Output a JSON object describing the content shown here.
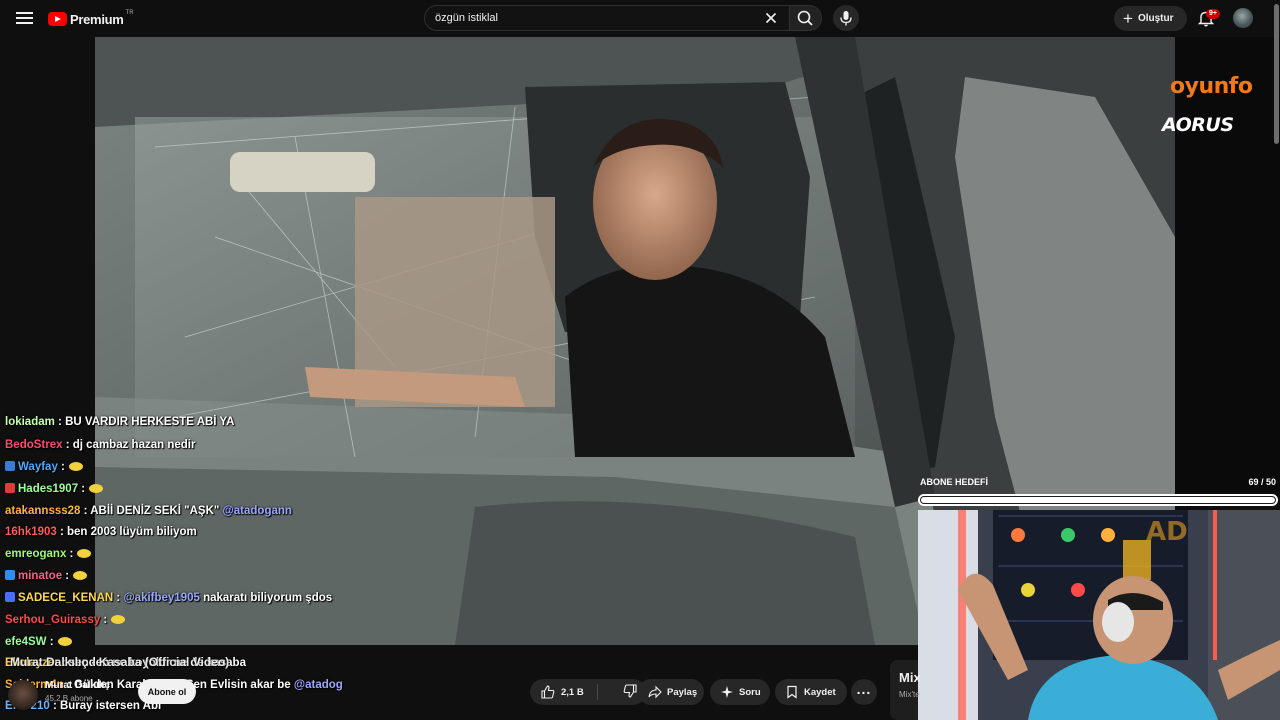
{
  "header": {
    "logo_text": "Premium",
    "logo_sup": "TR",
    "search_value": "özgün istiklal",
    "create_label": "Oluştur",
    "notification_badge": "9+"
  },
  "overlay": {
    "sponsor_1": "oyunfo",
    "sponsor_2": "AORUS",
    "goal_label": "ABONE HEDEFİ",
    "goal_count": "69 / 50",
    "goal_progress_fraction": 1.0
  },
  "chat": [
    {
      "user": "lokiadam",
      "user_color": "#c8ffb0",
      "message": " : BU VARDIR HERKESTE ABİ YA",
      "mention": "",
      "emote": false,
      "badge": ""
    },
    {
      "user": "BedoStrex",
      "user_color": "#ff4a6e",
      "message": " : dj cambaz hazan nedir",
      "mention": "",
      "emote": false,
      "badge": ""
    },
    {
      "user": "Wayfay",
      "user_color": "#4aa8ff",
      "message": " :",
      "mention": "",
      "emote": true,
      "badge": "#3a7bd5"
    },
    {
      "user": "Hades1907",
      "user_color": "#9aff9a",
      "message": " :",
      "mention": "",
      "emote": true,
      "badge": "#e03a3a"
    },
    {
      "user": "atakannsss28",
      "user_color": "#ffb347",
      "message": " : ABİİ DENİZ SEKİ \"AŞK\"",
      "mention": " @atadogann",
      "emote": false,
      "badge": ""
    },
    {
      "user": "16hk1903",
      "user_color": "#ff5b5b",
      "message": " : ben 2003 lüyüm biliyom",
      "mention": "",
      "emote": false,
      "badge": ""
    },
    {
      "user": "emreoganx",
      "user_color": "#9aff6a",
      "message": " :",
      "mention": "",
      "emote": true,
      "badge": ""
    },
    {
      "user": "minatoe",
      "user_color": "#ff5b8a",
      "message": " :",
      "mention": "",
      "emote": true,
      "badge": "#2b8fff"
    },
    {
      "user": "SADECE_KENAN",
      "user_color": "#ffd84a",
      "message": " : ",
      "mention": "@akifbey1905",
      "suffix": " nakaratı biliyorum şdos",
      "emote": false,
      "badge": "#4a6cff"
    },
    {
      "user": "Serhou_Guirassy",
      "user_color": "#ff4a4a",
      "message": " :",
      "mention": "",
      "emote": true,
      "badge": ""
    },
    {
      "user": "efe4SW",
      "user_color": "#9aff9a",
      "message": " :",
      "mention": "",
      "emote": true,
      "badge": ""
    },
    {
      "user": "Ekolayzer",
      "user_color": "#ffd84a",
      "message": " : senden ne koyolur ne de kasaba",
      "mention": "",
      "emote": false,
      "badge": ""
    },
    {
      "user": "Sejderm4n",
      "user_color": "#ffb347",
      "message": " : Gülden Karaböcek - Sen Evlisin akar be",
      "mention": " @atadog",
      "emote": false,
      "badge": ""
    },
    {
      "user": "Efoo210",
      "user_color": "#6ab7ff",
      "message": " : Buray istersen Abi",
      "mention": "",
      "emote": false,
      "badge": ""
    }
  ],
  "video": {
    "title": "Murat Dalkılıç - Kasaba (Official Video)",
    "channel": "Murat Dalkılıç",
    "subscribers": "45,2 B abone",
    "subscribe_label": "Abone ol",
    "likes": "2,1 B",
    "share_label": "Paylaş",
    "ask_label": "Soru",
    "save_label": "Kaydet",
    "more_label": "..."
  },
  "sidebar": {
    "mix_title": "Mix",
    "mix_sub": "Mix'te"
  }
}
